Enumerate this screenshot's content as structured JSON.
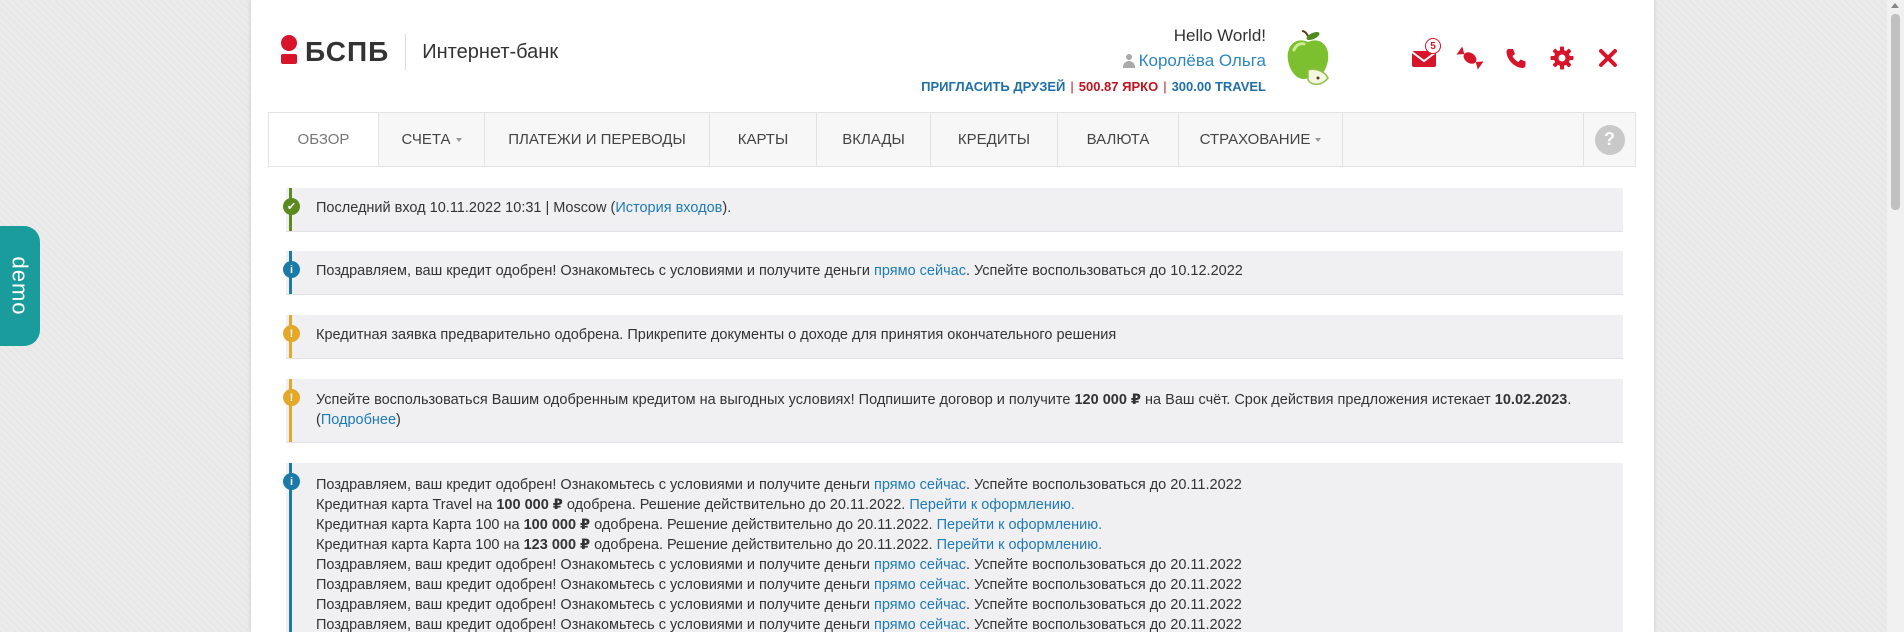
{
  "brand": {
    "logo_text": "БСПБ",
    "subtitle": "Интернет-банк"
  },
  "user": {
    "greeting": "Hello World!",
    "name": "Королёва Ольга",
    "invite_label": "ПРИГЛАСИТЬ ДРУЗЕЙ",
    "bonus_yarko": "500.87 ЯРКО",
    "bonus_travel": "300.00 TRAVEL"
  },
  "header_icons": [
    {
      "name": "envelope-icon",
      "badge": "5"
    },
    {
      "name": "candy-icon"
    },
    {
      "name": "phone-icon"
    },
    {
      "name": "gear-icon"
    },
    {
      "name": "close-icon"
    }
  ],
  "colors": {
    "brand_red": "#d7142a",
    "link_blue": "#1f7bb6",
    "success_green": "#5b8a1e",
    "info_blue": "#1a7aa8",
    "warning_yellow": "#e3a72a",
    "demo_teal": "#1a9c9c"
  },
  "nav": {
    "items": [
      {
        "label": "ОБЗОР",
        "active": true
      },
      {
        "label": "СЧЕТА",
        "dropdown": true
      },
      {
        "label": "ПЛАТЕЖИ И ПЕРЕВОДЫ"
      },
      {
        "label": "КАРТЫ"
      },
      {
        "label": "ВКЛАДЫ"
      },
      {
        "label": "КРЕДИТЫ"
      },
      {
        "label": "ВАЛЮТА"
      },
      {
        "label": "СТРАХОВАНИЕ",
        "dropdown": true
      }
    ],
    "help": "?"
  },
  "demo_tab": "demo",
  "alerts": {
    "last_login": {
      "prefix": "Последний вход 10.11.2022 10:31 | Moscow (",
      "link": "История входов",
      "suffix": ")."
    },
    "credit_approved_1": {
      "prefix": "Поздравляем, ваш кредит одобрен! Ознакомьтесь с условиями и получите деньги ",
      "link": "прямо сейчас",
      "suffix": ". Успейте воспользоваться до 10.12.2022"
    },
    "preliminary": {
      "text": "Кредитная заявка предварительно одобрена. Прикрепите документы о доходе для принятия окончательного решения"
    },
    "offer": {
      "t1": "Успейте воспользоваться Вашим одобренным кредитом на выгодных условиях! Подпишите договор и получите ",
      "amount": "120 000 ₽",
      "t2": " на Ваш счёт. Срок действия предложения истекает ",
      "date": "10.02.2023",
      "t3": ".",
      "open": "(",
      "link": "Подробнее",
      "close": ")"
    },
    "multi": {
      "line1_prefix": "Поздравляем, ваш кредит одобрен! Ознакомьтесь с условиями и получите деньги ",
      "line1_link": "прямо сейчас",
      "line1_suffix": ". Успейте воспользоваться до 20.11.2022",
      "card1_a": "Кредитная карта Travel на ",
      "card1_amount": "100 000 ₽",
      "card1_b": " одобрена. Решение действительно до 20.11.2022. ",
      "card1_link": "Перейти к оформлению.",
      "card2_a": "Кредитная карта Карта 100 на ",
      "card2_amount": "100 000 ₽",
      "card2_b": " одобрена. Решение действительно до 20.11.2022. ",
      "card2_link": "Перейти к оформлению.",
      "card3_a": "Кредитная карта Карта 100 на ",
      "card3_amount": "123 000 ₽",
      "card3_b": " одобрена. Решение действительно до 20.11.2022. ",
      "card3_link": "Перейти к оформлению.",
      "repeat_prefix": "Поздравляем, ваш кредит одобрен! Ознакомьтесь с условиями и получите деньги ",
      "repeat_link": "прямо сейчас",
      "repeat_suffix": ". Успейте воспользоваться до 20.11.2022"
    }
  }
}
